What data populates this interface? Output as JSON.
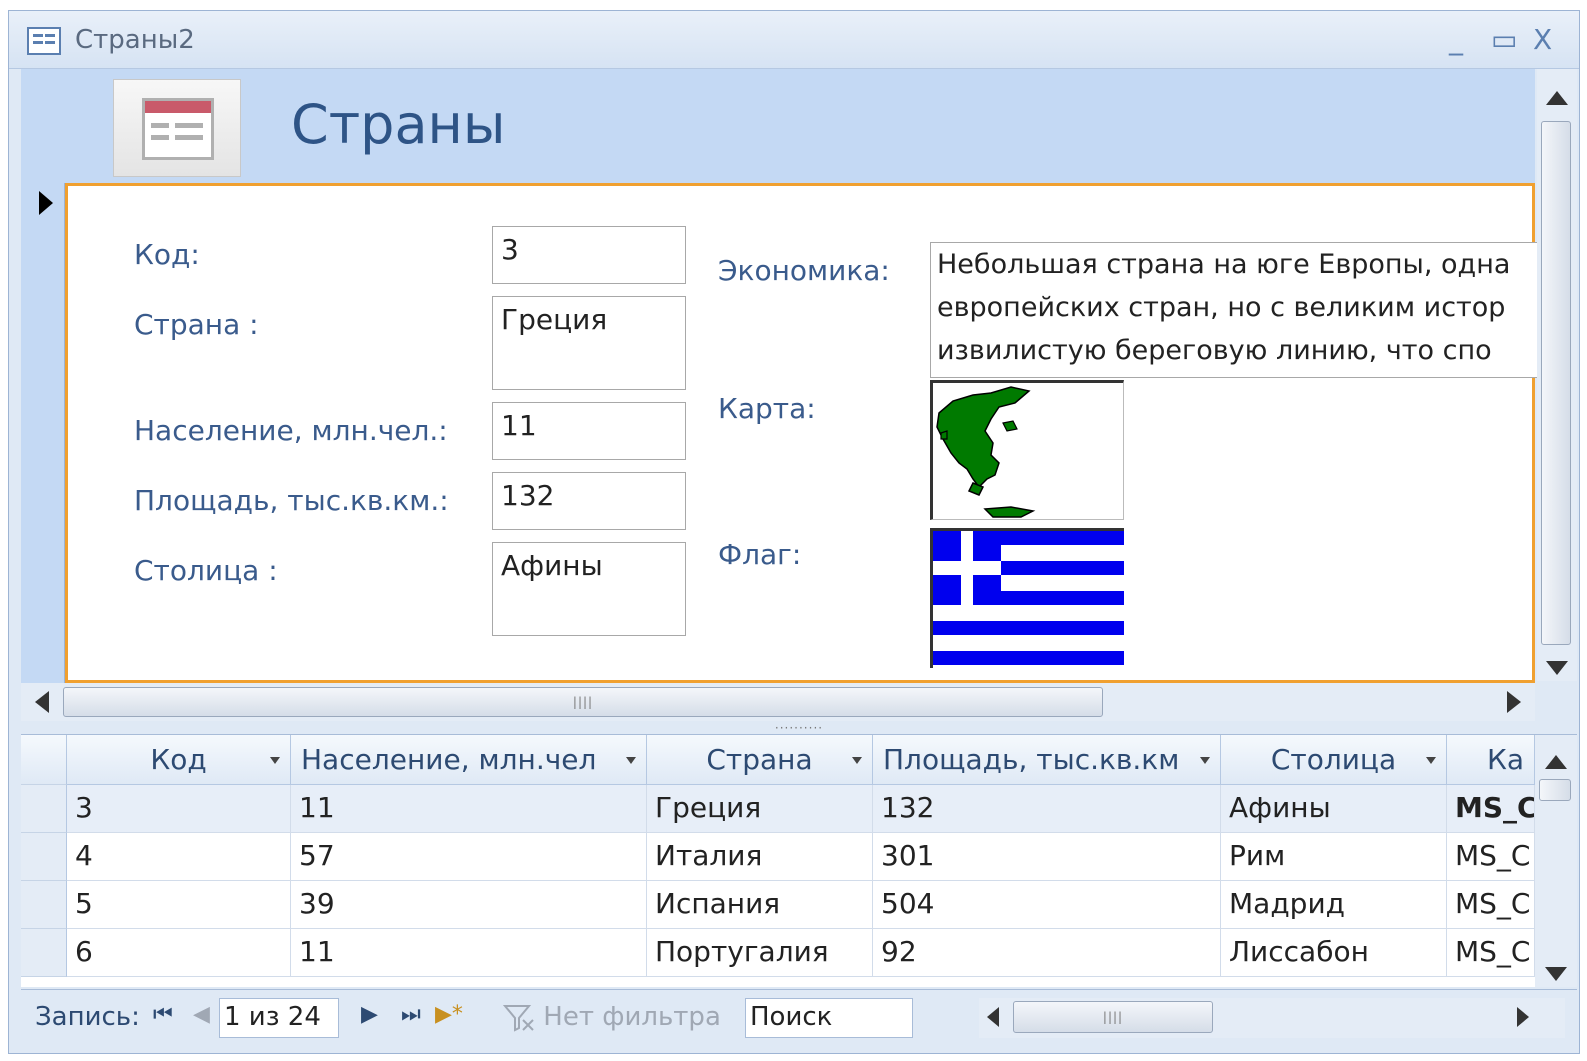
{
  "window": {
    "title": "Страны2",
    "minimize": "_",
    "maximize": "▭",
    "close": "X"
  },
  "form": {
    "title": "Страны",
    "labels": {
      "code": "Код:",
      "country": "Страна :",
      "population": "Население, млн.чел.:",
      "area": "Площадь, тыс.кв.км.:",
      "capital": "Столица :",
      "economy": "Экономика:",
      "map": "Карта:",
      "flag": "Флаг:"
    },
    "values": {
      "code": "3",
      "country": "Греция",
      "population": "11",
      "area": "132",
      "capital": "Афины"
    },
    "economy_lines": [
      "Небольшая страна на юге Европы, одна",
      "европейских стран, но с великим истор",
      "извилистую береговую линию, что спо"
    ],
    "map_icon": "greece-map-image",
    "flag_icon": "greece-flag-image",
    "flag_colors": {
      "blue": "#0000ee",
      "white": "#ffffff"
    },
    "map_color": "#007a00"
  },
  "datasheet": {
    "columns": [
      "Код",
      "Население, млн.чел",
      "Страна",
      "Площадь, тыс.кв.км",
      "Столица",
      "Ка"
    ],
    "rows": [
      [
        "3",
        "11",
        "Греция",
        "132",
        "Афины",
        "MS_C"
      ],
      [
        "4",
        "57",
        "Италия",
        "301",
        "Рим",
        "MS_C"
      ],
      [
        "5",
        "39",
        "Испания",
        "504",
        "Мадрид",
        "MS_C"
      ],
      [
        "6",
        "11",
        "Португалия",
        "92",
        "Лиссабон",
        "MS_C"
      ]
    ]
  },
  "navbar": {
    "record_label": "Запись:",
    "first": "⏮",
    "prev": "◀",
    "position": "1 из 24",
    "next": "▶",
    "last": "⏭",
    "new": "▶*",
    "filter": "Нет фильтра",
    "search": "Поиск"
  },
  "accent": {
    "border": "#f0a030",
    "header": "#c4d9f4",
    "title": "#2e5486"
  }
}
